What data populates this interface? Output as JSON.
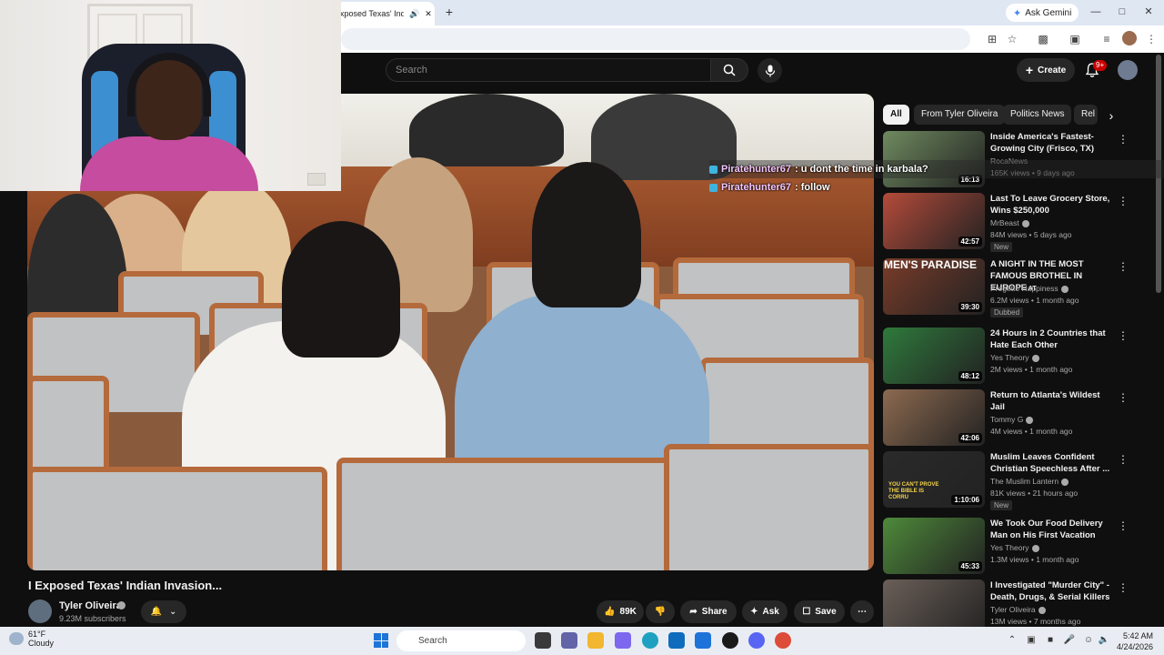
{
  "browser": {
    "tab_title": "xposed Texas' Indian I",
    "ask_gemini": "Ask Gemini",
    "new_tab_glyph": "+"
  },
  "youtube": {
    "search_placeholder": "Search",
    "create_label": "Create",
    "notif_badge": "9+",
    "chat": [
      {
        "user": "Piratehunter67",
        "message": ": u dont the time in karbala?"
      },
      {
        "user": "Piratehunter67",
        "message": ": follow"
      }
    ],
    "video": {
      "title": "I Exposed Texas' Indian Invasion...",
      "channel": "Tyler Oliveira",
      "subscribers": "9.23M subscribers",
      "likes": "89K",
      "share_label": "Share",
      "ask_label": "Ask",
      "save_label": "Save"
    },
    "chips": [
      "All",
      "From Tyler Oliveira",
      "Politics News",
      "Rel"
    ],
    "recommendations": [
      {
        "title": "Inside America's Fastest-Growing City (Frisco, TX)",
        "channel": "RocaNews",
        "meta": "165K views • 9 days ago",
        "duration": "16:13",
        "verified": false,
        "tag": "",
        "thumb_color": "#6f8a5f"
      },
      {
        "title": "Last To Leave Grocery Store, Wins $250,000",
        "channel": "MrBeast",
        "meta": "84M views • 5 days ago",
        "duration": "42:57",
        "verified": true,
        "tag": "New",
        "thumb_color": "#b54b3a"
      },
      {
        "title": "A NIGHT IN THE MOST FAMOUS BROTHEL IN EUROPE",
        "channel": "Progetto Happiness",
        "meta": "6.2M views • 1 month ago",
        "duration": "39:30",
        "verified": true,
        "tag": "Dubbed",
        "thumb_color": "#7a3c2a",
        "title_suffix": "AT"
      },
      {
        "title": "24 Hours in 2 Countries that Hate Each Other",
        "channel": "Yes Theory",
        "meta": "2M views • 1 month ago",
        "duration": "48:12",
        "verified": true,
        "tag": "",
        "thumb_color": "#2f7a3c"
      },
      {
        "title": "Return to Atlanta's Wildest Jail",
        "channel": "Tommy G",
        "meta": "4M views • 1 month ago",
        "duration": "42:06",
        "verified": true,
        "tag": "",
        "thumb_color": "#8d6a50"
      },
      {
        "title": "Muslim Leaves Confident Christian Speechless After ...",
        "channel": "The Muslim Lantern",
        "meta": "81K views • 21 hours ago",
        "duration": "1:10:06",
        "verified": true,
        "tag": "New",
        "thumb_color": "#2a2a2a",
        "overlay": "YOU CAN'T PROVE THE BIBLE IS CORRU"
      },
      {
        "title": "We Took Our Food Delivery Man on His First Vacation",
        "channel": "Yes Theory",
        "meta": "1.3M views • 1 month ago",
        "duration": "45:33",
        "verified": true,
        "tag": "",
        "thumb_color": "#4e8a3a"
      },
      {
        "title": "I Investigated \"Murder City\" - Death, Drugs, & Serial Killers",
        "channel": "Tyler Oliveira",
        "meta": "13M views • 7 months ago",
        "duration": "",
        "verified": true,
        "tag": "",
        "thumb_color": "#6b5f58"
      }
    ],
    "thumb_overlay_text": "MEN'S PARADISE"
  },
  "taskbar": {
    "temperature": "61°F",
    "condition": "Cloudy",
    "search_label": "Search",
    "time": "5:42 AM",
    "date": "4/24/2026"
  },
  "icons": [
    "search-icon",
    "mic-icon",
    "bell-icon",
    "plus-icon",
    "like-icon",
    "dislike-icon",
    "share-icon",
    "sparkle-icon",
    "save-icon",
    "more-icon",
    "chevron-right-icon",
    "chevron-down-icon",
    "windows-icon",
    "wifi-icon",
    "volume-icon",
    "battery-icon"
  ]
}
